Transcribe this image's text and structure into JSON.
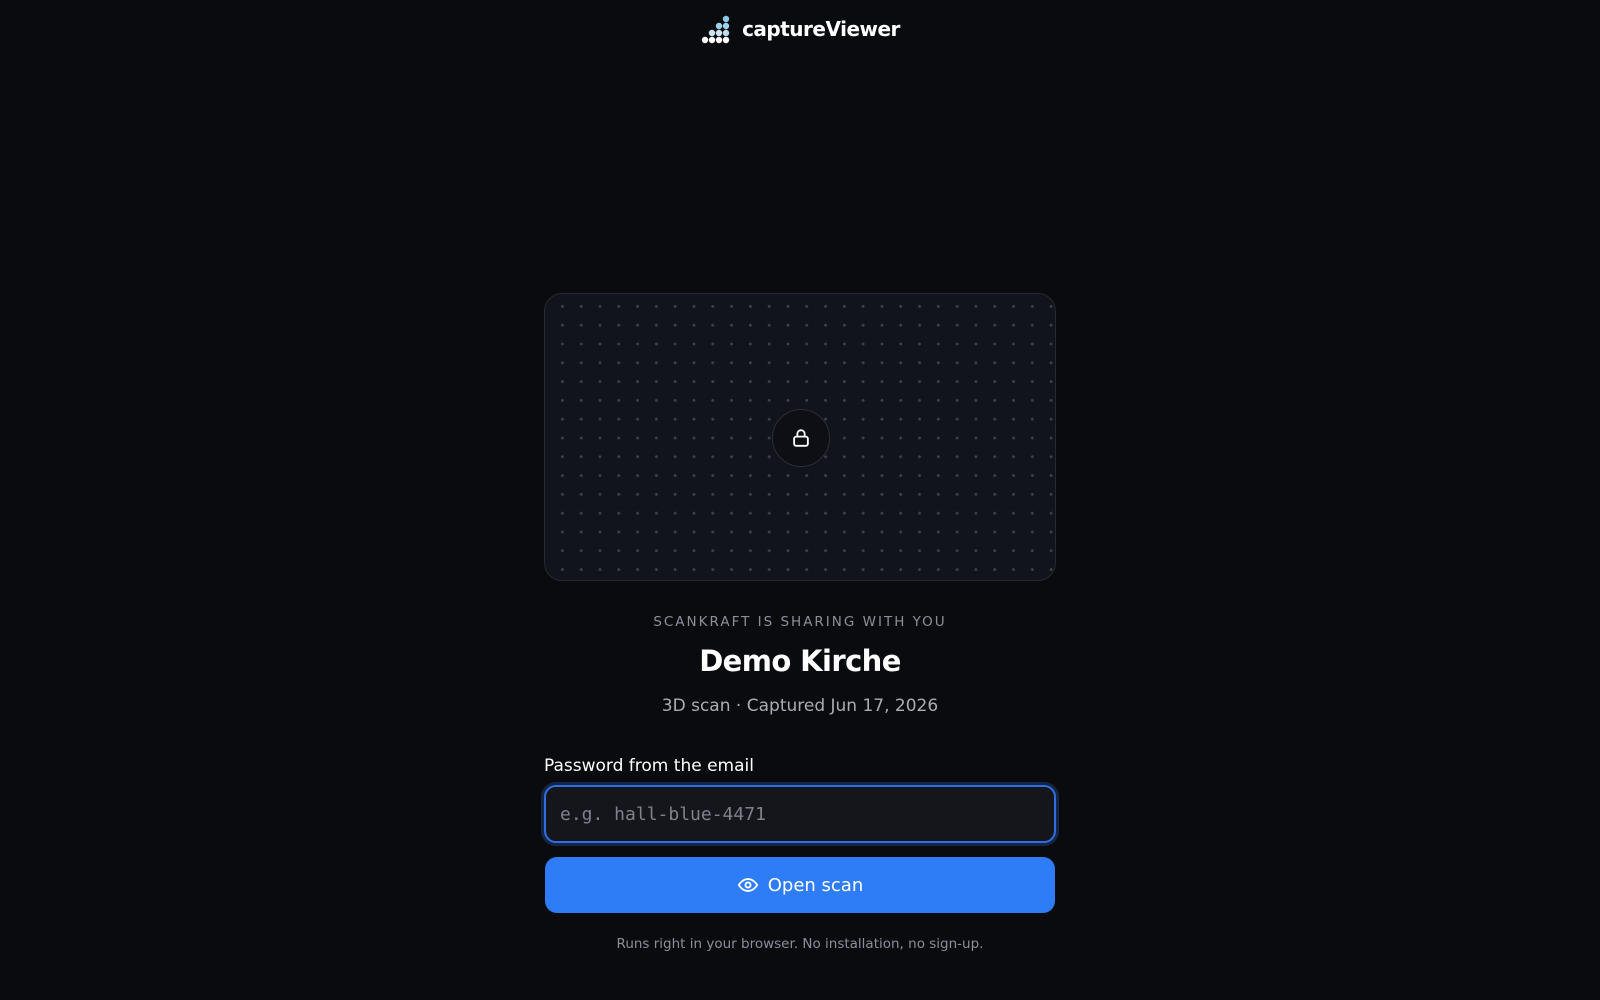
{
  "brand": {
    "name": "captureViewer",
    "logo_icon": "dot-stairs-logo-icon"
  },
  "preview": {
    "icon": "lock-icon"
  },
  "share": {
    "eyebrow": "SCANKRAFT IS SHARING WITH YOU",
    "title": "Demo Kirche",
    "type": "3D scan",
    "separator": "·",
    "captured": "Captured Jun 17, 2026"
  },
  "form": {
    "password_label": "Password from the email",
    "password_value": "",
    "password_placeholder": "e.g. hall-blue-4471",
    "submit_label": "Open scan",
    "submit_icon": "eye-icon"
  },
  "footnote": "Runs right in your browser. No installation, no sign-up.",
  "colors": {
    "background": "#0a0b0f",
    "accent": "#2f7df6",
    "focus_ring": "#2f6fe0",
    "muted_text": "#8a8f99"
  }
}
